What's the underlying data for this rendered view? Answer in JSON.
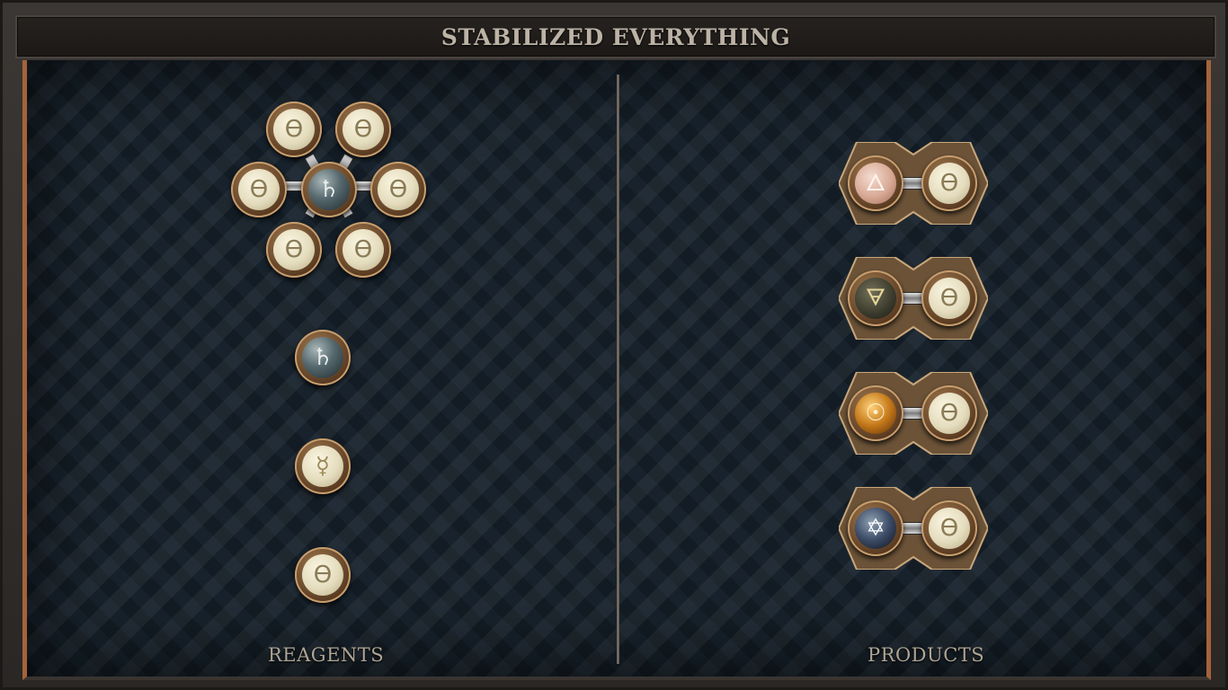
{
  "title": "STABILIZED EVERYTHING",
  "reagents": {
    "label": "REAGENTS",
    "molecule": {
      "center": {
        "glyph": "♄",
        "element": "lead-icon"
      },
      "ring": [
        "ϴ",
        "ϴ",
        "ϴ",
        "ϴ",
        "ϴ",
        "ϴ"
      ]
    },
    "singles": [
      {
        "glyph": "♄",
        "element": "lead"
      },
      {
        "glyph": "☿",
        "element": "quicksilver"
      },
      {
        "glyph": "ϴ",
        "element": "salt"
      }
    ]
  },
  "products": {
    "label": "PRODUCTS",
    "items": [
      {
        "left": "🜂",
        "left_element": "fire",
        "right": "ϴ"
      },
      {
        "left": "🜃",
        "left_element": "earth",
        "right": "ϴ"
      },
      {
        "left": "☉",
        "left_element": "gold",
        "right": "ϴ"
      },
      {
        "left": "✡",
        "left_element": "vitae",
        "right": "ϴ"
      }
    ]
  }
}
